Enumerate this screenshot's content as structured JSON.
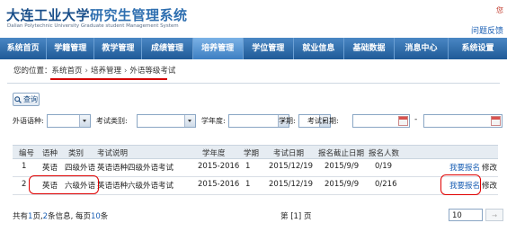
{
  "header": {
    "school_bold": "大连工业大学",
    "school_rest": "研究生管理系统",
    "subtitle": "Dalian Polytechnic University Graduate student Management System",
    "top_right_mark": "您",
    "feedback": "问题反馈"
  },
  "nav": {
    "items": [
      "系统首页",
      "学籍管理",
      "教学管理",
      "成绩管理",
      "培养管理",
      "学位管理",
      "就业信息",
      "基础数据",
      "消息中心",
      "系统设置"
    ],
    "active_index": 4
  },
  "breadcrumb": {
    "prefix": "您的位置：",
    "items": [
      "系统首页",
      "培养管理",
      "外语等级考试"
    ],
    "sep": "›"
  },
  "search": {
    "label": "查询"
  },
  "filters": {
    "language": "外语语种:",
    "category": "考试类别:",
    "year": "学年度:",
    "term": "学期:",
    "date": "考试日期:",
    "dash": "-"
  },
  "table": {
    "headers": [
      "编号",
      "语种",
      "类别",
      "考试说明",
      "学年度",
      "学期",
      "考试日期",
      "报名截止日期",
      "报名人数"
    ],
    "rows": [
      {
        "no": "1",
        "lang": "英语",
        "cat": "四级外语",
        "desc": "英语语种四级外语考试",
        "year": "2015-2016",
        "term": "1",
        "date": "2015/12/19",
        "deadline": "2015/9/9",
        "count": "0/19",
        "signup": "我要报名",
        "edit": "修改"
      },
      {
        "no": "2",
        "lang": "英语",
        "cat": "六级外语",
        "desc": "英语语种六级外语考试",
        "year": "2015-2016",
        "term": "1",
        "date": "2015/12/19",
        "deadline": "2015/9/9",
        "count": "0/216",
        "signup": "我要报名",
        "edit": "修改"
      }
    ]
  },
  "footer": {
    "t1": "共有",
    "pages": "1",
    "t2": "页,",
    "records": "2",
    "t3": "条信息, 每页",
    "per_page": "10",
    "t4": "条",
    "page_text": "第 [1] 页",
    "page_size": "10",
    "go": "→"
  },
  "colors": {
    "nav": "#2f6aa8",
    "link": "#1a5fb4",
    "annotation": "#e00000"
  }
}
